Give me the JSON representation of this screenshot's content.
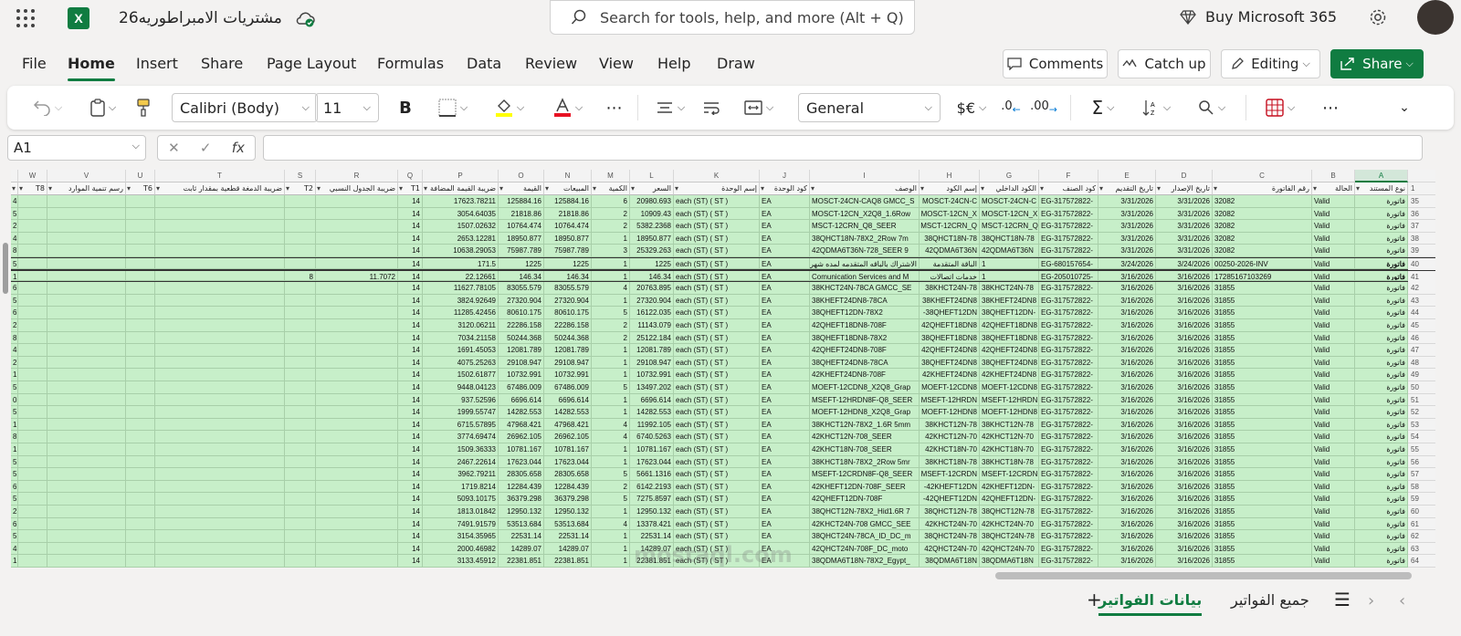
{
  "app": {
    "name": "Excel",
    "file_title": "مشتريات الامبراطوريه26",
    "search_placeholder": "Search for tools, help, and more (Alt + Q)",
    "buy_label": "Buy Microsoft 365"
  },
  "menu": {
    "tabs": [
      "File",
      "Home",
      "Insert",
      "Share",
      "Page Layout",
      "Formulas",
      "Data",
      "Review",
      "View",
      "Help",
      "Draw"
    ],
    "active": "Home",
    "comments": "Comments",
    "catchup": "Catch up",
    "editing": "Editing",
    "share": "Share"
  },
  "ribbon": {
    "font": "Calibri (Body)",
    "size": "11",
    "number_format": "General",
    "currency_symbol": "$€",
    "fx_label": "fx"
  },
  "formula_bar": {
    "cell_ref": "A1",
    "value": ""
  },
  "columns": [
    {
      "letter": "A",
      "header": "نوع المستند"
    },
    {
      "letter": "B",
      "header": "الحالة"
    },
    {
      "letter": "C",
      "header": "رقم الفاتورة"
    },
    {
      "letter": "D",
      "header": "تاريخ الإصدار"
    },
    {
      "letter": "E",
      "header": "تاريخ التقديم"
    },
    {
      "letter": "F",
      "header": "كود الصنف"
    },
    {
      "letter": "G",
      "header": "الكود الداخلي"
    },
    {
      "letter": "H",
      "header": "إسم الكود"
    },
    {
      "letter": "I",
      "header": "الوصف"
    },
    {
      "letter": "J",
      "header": "كود الوحدة"
    },
    {
      "letter": "K",
      "header": "إسم الوحدة"
    },
    {
      "letter": "L",
      "header": "السعر"
    },
    {
      "letter": "M",
      "header": "الكمية"
    },
    {
      "letter": "N",
      "header": "المبيعات"
    },
    {
      "letter": "O",
      "header": "القيمة"
    },
    {
      "letter": "P",
      "header": "ضريبة القيمة المضافة"
    },
    {
      "letter": "Q",
      "header": "T1"
    },
    {
      "letter": "R",
      "header": "ضريبة الجدول النسبي"
    },
    {
      "letter": "S",
      "header": "T2"
    },
    {
      "letter": "T",
      "header": "ضريبة الدمغة قطعية بمقدار ثابت"
    },
    {
      "letter": "U",
      "header": "T6"
    },
    {
      "letter": "V",
      "header": "رسم تنمية الموارد"
    },
    {
      "letter": "W",
      "header": "T8"
    }
  ],
  "rows": [
    {
      "n": "35",
      "A": "فاتورة",
      "B": "Valid",
      "C": "32082",
      "D": "3/31/2026",
      "E": "3/31/2026",
      "F": "EG-317572822-",
      "G": "MOSCT-24CN-C",
      "H": "MOSCT-24CN-C",
      "I": "MOSCT-24CN-CAQ8 GMCC_S",
      "J": "EA",
      "K": "each (ST) ( ST )",
      "L": "20980.693",
      "M": "6",
      "N": "125884.16",
      "O": "125884.16",
      "P": "17623.78211",
      "Q": "14",
      "R": "",
      "S": "",
      "edge": "4"
    },
    {
      "n": "36",
      "A": "فاتورة",
      "B": "Valid",
      "C": "32082",
      "D": "3/31/2026",
      "E": "3/31/2026",
      "F": "EG-317572822-",
      "G": "MOSCT-12CN_X",
      "H": "MOSCT-12CN_X",
      "I": "MOSCT-12CN_X2Q8_1.6Row",
      "J": "EA",
      "K": "each (ST) ( ST )",
      "L": "10909.43",
      "M": "2",
      "N": "21818.86",
      "O": "21818.86",
      "P": "3054.64035",
      "Q": "14",
      "R": "",
      "S": "",
      "edge": "5"
    },
    {
      "n": "37",
      "A": "فاتورة",
      "B": "Valid",
      "C": "32082",
      "D": "3/31/2026",
      "E": "3/31/2026",
      "F": "EG-317572822-",
      "G": "MSCT-12CRN_Q",
      "H": "MSCT-12CRN_Q",
      "I": "MSCT-12CRN_Q8_SEER",
      "J": "EA",
      "K": "each (ST) ( ST )",
      "L": "5382.2368",
      "M": "2",
      "N": "10764.474",
      "O": "10764.474",
      "P": "1507.02632",
      "Q": "14",
      "R": "",
      "S": "",
      "edge": "2"
    },
    {
      "n": "38",
      "A": "فاتورة",
      "B": "Valid",
      "C": "32082",
      "D": "3/31/2026",
      "E": "3/31/2026",
      "F": "EG-317572822-",
      "G": "38QHCT18N-78",
      "H": "38QHCT18N-78",
      "I": "38QHCT18N-78X2_2Row 7m",
      "J": "EA",
      "K": "each (ST) ( ST )",
      "L": "18950.877",
      "M": "1",
      "N": "18950.877",
      "O": "18950.877",
      "P": "2653.12281",
      "Q": "14",
      "R": "",
      "S": "",
      "edge": "4"
    },
    {
      "n": "39",
      "A": "فاتورة",
      "B": "Valid",
      "C": "32082",
      "D": "3/31/2026",
      "E": "3/31/2026",
      "F": "EG-317572822-",
      "G": "42QDMA6T36N",
      "H": "42QDMA6T36N",
      "I": "42QDMA6T36N-728_SEER 9",
      "J": "EA",
      "K": "each (ST) ( ST )",
      "L": "25329.263",
      "M": "3",
      "N": "75987.789",
      "O": "75987.789",
      "P": "10638.29053",
      "Q": "14",
      "R": "",
      "S": "",
      "edge": "8"
    },
    {
      "n": "40",
      "A": "فاتورة",
      "B": "Valid",
      "C": "00250-2026-INV",
      "D": "3/24/2026",
      "E": "3/24/2026",
      "F": "EG-680157654-",
      "G": "1",
      "H": "الباقة المتقدمة",
      "I": "الاشتراك بالباقه المتقدمه لمده شهر--",
      "J": "EA",
      "K": "each (ST) ( ST )",
      "L": "1225",
      "M": "1",
      "N": "1225",
      "O": "1225",
      "P": "171.5",
      "Q": "14",
      "R": "",
      "S": "",
      "edge": "5",
      "bold": true
    },
    {
      "n": "41",
      "A": "فاتورة",
      "B": "Valid",
      "C": "17285167103269",
      "D": "3/16/2026",
      "E": "3/16/2026",
      "F": "EG-205010725-",
      "G": "1",
      "H": "خدمات اتصالات",
      "I": "Comunication Services and M",
      "J": "EA",
      "K": "each (ST) ( ST )",
      "L": "146.34",
      "M": "1",
      "N": "146.34",
      "O": "146.34",
      "P": "22.12661",
      "Q": "14",
      "R": "11.7072",
      "S": "8",
      "edge": "1",
      "bold": true
    },
    {
      "n": "42",
      "A": "فاتورة",
      "B": "Valid",
      "C": "31855",
      "D": "3/16/2026",
      "E": "3/16/2026",
      "F": "EG-317572822-",
      "G": "38KHCT24N-78",
      "H": "38KHCT24N-78",
      "I": "38KHCT24N-78CA GMCC_SE",
      "J": "EA",
      "K": "each (ST) ( ST )",
      "L": "20763.895",
      "M": "4",
      "N": "83055.579",
      "O": "83055.579",
      "P": "11627.78105",
      "Q": "14",
      "R": "",
      "S": "",
      "edge": "6"
    },
    {
      "n": "43",
      "A": "فاتورة",
      "B": "Valid",
      "C": "31855",
      "D": "3/16/2026",
      "E": "3/16/2026",
      "F": "EG-317572822-",
      "G": "38KHEFT24DN8",
      "H": "38KHEFT24DN8",
      "I": "38KHEFT24DN8-78CA",
      "J": "EA",
      "K": "each (ST) ( ST )",
      "L": "27320.904",
      "M": "1",
      "N": "27320.904",
      "O": "27320.904",
      "P": "3824.92649",
      "Q": "14",
      "R": "",
      "S": "",
      "edge": "5"
    },
    {
      "n": "44",
      "A": "فاتورة",
      "B": "Valid",
      "C": "31855",
      "D": "3/16/2026",
      "E": "3/16/2026",
      "F": "EG-317572822-",
      "G": "38QHEFT12DN-",
      "H": "38QHEFT12DN-",
      "I": "38QHEFT12DN-78X2",
      "J": "EA",
      "K": "each (ST) ( ST )",
      "L": "16122.035",
      "M": "5",
      "N": "80610.175",
      "O": "80610.175",
      "P": "11285.42456",
      "Q": "14",
      "R": "",
      "S": "",
      "edge": "6"
    },
    {
      "n": "45",
      "A": "فاتورة",
      "B": "Valid",
      "C": "31855",
      "D": "3/16/2026",
      "E": "3/16/2026",
      "F": "EG-317572822-",
      "G": "42QHEFT18DN8",
      "H": "42QHEFT18DN8",
      "I": "42QHEFT18DN8-708F",
      "J": "EA",
      "K": "each (ST) ( ST )",
      "L": "11143.079",
      "M": "2",
      "N": "22286.158",
      "O": "22286.158",
      "P": "3120.06211",
      "Q": "14",
      "R": "",
      "S": "",
      "edge": "2"
    },
    {
      "n": "46",
      "A": "فاتورة",
      "B": "Valid",
      "C": "31855",
      "D": "3/16/2026",
      "E": "3/16/2026",
      "F": "EG-317572822-",
      "G": "38QHEFT18DN8",
      "H": "38QHEFT18DN8",
      "I": "38QHEFT18DN8-78X2",
      "J": "EA",
      "K": "each (ST) ( ST )",
      "L": "25122.184",
      "M": "2",
      "N": "50244.368",
      "O": "50244.368",
      "P": "7034.21158",
      "Q": "14",
      "R": "",
      "S": "",
      "edge": "8"
    },
    {
      "n": "47",
      "A": "فاتورة",
      "B": "Valid",
      "C": "31855",
      "D": "3/16/2026",
      "E": "3/16/2026",
      "F": "EG-317572822-",
      "G": "42QHEFT24DN8",
      "H": "42QHEFT24DN8",
      "I": "42QHEFT24DN8-708F",
      "J": "EA",
      "K": "each (ST) ( ST )",
      "L": "12081.789",
      "M": "1",
      "N": "12081.789",
      "O": "12081.789",
      "P": "1691.45053",
      "Q": "14",
      "R": "",
      "S": "",
      "edge": "4"
    },
    {
      "n": "48",
      "A": "فاتورة",
      "B": "Valid",
      "C": "31855",
      "D": "3/16/2026",
      "E": "3/16/2026",
      "F": "EG-317572822-",
      "G": "38QHEFT24DN8",
      "H": "38QHEFT24DN8",
      "I": "38QHEFT24DN8-78CA",
      "J": "EA",
      "K": "each (ST) ( ST )",
      "L": "29108.947",
      "M": "1",
      "N": "29108.947",
      "O": "29108.947",
      "P": "4075.25263",
      "Q": "14",
      "R": "",
      "S": "",
      "edge": "2"
    },
    {
      "n": "49",
      "A": "فاتورة",
      "B": "Valid",
      "C": "31855",
      "D": "3/16/2026",
      "E": "3/16/2026",
      "F": "EG-317572822-",
      "G": "42KHEFT24DN8",
      "H": "42KHEFT24DN8",
      "I": "42KHEFT24DN8-708F",
      "J": "EA",
      "K": "each (ST) ( ST )",
      "L": "10732.991",
      "M": "1",
      "N": "10732.991",
      "O": "10732.991",
      "P": "1502.61877",
      "Q": "14",
      "R": "",
      "S": "",
      "edge": "1"
    },
    {
      "n": "50",
      "A": "فاتورة",
      "B": "Valid",
      "C": "31855",
      "D": "3/16/2026",
      "E": "3/16/2026",
      "F": "EG-317572822-",
      "G": "MOEFT-12CDN8",
      "H": "MOEFT-12CDN8",
      "I": "MOEFT-12CDN8_X2Q8_Grap",
      "J": "EA",
      "K": "each (ST) ( ST )",
      "L": "13497.202",
      "M": "5",
      "N": "67486.009",
      "O": "67486.009",
      "P": "9448.04123",
      "Q": "14",
      "R": "",
      "S": "",
      "edge": "5"
    },
    {
      "n": "51",
      "A": "فاتورة",
      "B": "Valid",
      "C": "31855",
      "D": "3/16/2026",
      "E": "3/16/2026",
      "F": "EG-317572822-",
      "G": "MSEFT-12HRDN",
      "H": "MSEFT-12HRDN",
      "I": "MSEFT-12HRDN8F-Q8_SEER",
      "J": "EA",
      "K": "each (ST) ( ST )",
      "L": "6696.614",
      "M": "1",
      "N": "6696.614",
      "O": "6696.614",
      "P": "937.52596",
      "Q": "14",
      "R": "",
      "S": "",
      "edge": "0"
    },
    {
      "n": "52",
      "A": "فاتورة",
      "B": "Valid",
      "C": "31855",
      "D": "3/16/2026",
      "E": "3/16/2026",
      "F": "EG-317572822-",
      "G": "MOEFT-12HDN8",
      "H": "MOEFT-12HDN8",
      "I": "MOEFT-12HDN8_X2Q8_Grap",
      "J": "EA",
      "K": "each (ST) ( ST )",
      "L": "14282.553",
      "M": "1",
      "N": "14282.553",
      "O": "14282.553",
      "P": "1999.55747",
      "Q": "14",
      "R": "",
      "S": "",
      "edge": "5"
    },
    {
      "n": "53",
      "A": "فاتورة",
      "B": "Valid",
      "C": "31855",
      "D": "3/16/2026",
      "E": "3/16/2026",
      "F": "EG-317572822-",
      "G": "38KHCT12N-78",
      "H": "38KHCT12N-78",
      "I": "38KHCT12N-78X2_1.6R 5mm",
      "J": "EA",
      "K": "each (ST) ( ST )",
      "L": "11992.105",
      "M": "4",
      "N": "47968.421",
      "O": "47968.421",
      "P": "6715.57895",
      "Q": "14",
      "R": "",
      "S": "",
      "edge": "1"
    },
    {
      "n": "54",
      "A": "فاتورة",
      "B": "Valid",
      "C": "31855",
      "D": "3/16/2026",
      "E": "3/16/2026",
      "F": "EG-317572822-",
      "G": "42KHCT12N-70",
      "H": "42KHCT12N-70",
      "I": "42KHCT12N-708_SEER",
      "J": "EA",
      "K": "each (ST) ( ST )",
      "L": "6740.5263",
      "M": "4",
      "N": "26962.105",
      "O": "26962.105",
      "P": "3774.69474",
      "Q": "14",
      "R": "",
      "S": "",
      "edge": "8"
    },
    {
      "n": "55",
      "A": "فاتورة",
      "B": "Valid",
      "C": "31855",
      "D": "3/16/2026",
      "E": "3/16/2026",
      "F": "EG-317572822-",
      "G": "42KHCT18N-70",
      "H": "42KHCT18N-70",
      "I": "42KHCT18N-708_SEER",
      "J": "EA",
      "K": "each (ST) ( ST )",
      "L": "10781.167",
      "M": "1",
      "N": "10781.167",
      "O": "10781.167",
      "P": "1509.36333",
      "Q": "14",
      "R": "",
      "S": "",
      "edge": "1"
    },
    {
      "n": "56",
      "A": "فاتورة",
      "B": "Valid",
      "C": "31855",
      "D": "3/16/2026",
      "E": "3/16/2026",
      "F": "EG-317572822-",
      "G": "38KHCT18N-78",
      "H": "38KHCT18N-78",
      "I": "38KHCT18N-78X2_2Row 5mr",
      "J": "EA",
      "K": "each (ST) ( ST )",
      "L": "17623.044",
      "M": "1",
      "N": "17623.044",
      "O": "17623.044",
      "P": "2467.22614",
      "Q": "14",
      "R": "",
      "S": "",
      "edge": "5"
    },
    {
      "n": "57",
      "A": "فاتورة",
      "B": "Valid",
      "C": "31855",
      "D": "3/16/2026",
      "E": "3/16/2026",
      "F": "EG-317572822-",
      "G": "MSEFT-12CRDN",
      "H": "MSEFT-12CRDN",
      "I": "MSEFT-12CRDN8F-Q8_SEER",
      "J": "EA",
      "K": "each (ST) ( ST )",
      "L": "5661.1316",
      "M": "5",
      "N": "28305.658",
      "O": "28305.658",
      "P": "3962.79211",
      "Q": "14",
      "R": "",
      "S": "",
      "edge": "5"
    },
    {
      "n": "58",
      "A": "فاتورة",
      "B": "Valid",
      "C": "31855",
      "D": "3/16/2026",
      "E": "3/16/2026",
      "F": "EG-317572822-",
      "G": "42KHEFT12DN-",
      "H": "42KHEFT12DN-",
      "I": "42KHEFT12DN-708F_SEER",
      "J": "EA",
      "K": "each (ST) ( ST )",
      "L": "6142.2193",
      "M": "2",
      "N": "12284.439",
      "O": "12284.439",
      "P": "1719.8214",
      "Q": "14",
      "R": "",
      "S": "",
      "edge": "6"
    },
    {
      "n": "59",
      "A": "فاتورة",
      "B": "Valid",
      "C": "31855",
      "D": "3/16/2026",
      "E": "3/16/2026",
      "F": "EG-317572822-",
      "G": "42QHEFT12DN-",
      "H": "42QHEFT12DN-",
      "I": "42QHEFT12DN-708F",
      "J": "EA",
      "K": "each (ST) ( ST )",
      "L": "7275.8597",
      "M": "5",
      "N": "36379.298",
      "O": "36379.298",
      "P": "5093.10175",
      "Q": "14",
      "R": "",
      "S": "",
      "edge": "5"
    },
    {
      "n": "60",
      "A": "فاتورة",
      "B": "Valid",
      "C": "31855",
      "D": "3/16/2026",
      "E": "3/16/2026",
      "F": "EG-317572822-",
      "G": "38QHCT12N-78",
      "H": "38QHCT12N-78",
      "I": "38QHCT12N-78X2_Hid1.6R 7",
      "J": "EA",
      "K": "each (ST) ( ST )",
      "L": "12950.132",
      "M": "1",
      "N": "12950.132",
      "O": "12950.132",
      "P": "1813.01842",
      "Q": "14",
      "R": "",
      "S": "",
      "edge": "2"
    },
    {
      "n": "61",
      "A": "فاتورة",
      "B": "Valid",
      "C": "31855",
      "D": "3/16/2026",
      "E": "3/16/2026",
      "F": "EG-317572822-",
      "G": "42KHCT24N-70",
      "H": "42KHCT24N-70",
      "I": "42KHCT24N-708 GMCC_SEE",
      "J": "EA",
      "K": "each (ST) ( ST )",
      "L": "13378.421",
      "M": "4",
      "N": "53513.684",
      "O": "53513.684",
      "P": "7491.91579",
      "Q": "14",
      "R": "",
      "S": "",
      "edge": "6"
    },
    {
      "n": "62",
      "A": "فاتورة",
      "B": "Valid",
      "C": "31855",
      "D": "3/16/2026",
      "E": "3/16/2026",
      "F": "EG-317572822-",
      "G": "38QHCT24N-78",
      "H": "38QHCT24N-78",
      "I": "38QHCT24N-78CA_ID_DC_m",
      "J": "EA",
      "K": "each (ST) ( ST )",
      "L": "22531.14",
      "M": "1",
      "N": "22531.14",
      "O": "22531.14",
      "P": "3154.35965",
      "Q": "14",
      "R": "",
      "S": "",
      "edge": "5"
    },
    {
      "n": "63",
      "A": "فاتورة",
      "B": "Valid",
      "C": "31855",
      "D": "3/16/2026",
      "E": "3/16/2026",
      "F": "EG-317572822-",
      "G": "42QHCT24N-70",
      "H": "42QHCT24N-70",
      "I": "42QHCT24N-708F_DC_moto",
      "J": "EA",
      "K": "each (ST) ( ST )",
      "L": "14289.07",
      "M": "1",
      "N": "14289.07",
      "O": "14289.07",
      "P": "2000.46982",
      "Q": "14",
      "R": "",
      "S": "",
      "edge": "4"
    },
    {
      "n": "64",
      "A": "فاتورة",
      "B": "Valid",
      "C": "31855",
      "D": "3/16/2026",
      "E": "3/16/2026",
      "F": "EG-317572822-",
      "G": "38QDMA6T18N",
      "H": "38QDMA6T18N",
      "I": "38QDMA6T18N-78X2_Egypt_",
      "J": "EA",
      "K": "each (ST) ( ST )",
      "L": "22381.851",
      "M": "1",
      "N": "22381.851",
      "O": "22381.851",
      "P": "3133.45912",
      "Q": "14",
      "R": "",
      "S": "",
      "edge": "1"
    }
  ],
  "sheets": {
    "tabs": [
      "بيانات الفواتير",
      "جميع الفواتير"
    ],
    "active": "بيانات الفواتير"
  },
  "watermark": {
    "text": "mostaql.com"
  },
  "colors": {
    "brand": "#107c41",
    "row_fill": "#c7efc9",
    "header": "#f3f3f3"
  }
}
